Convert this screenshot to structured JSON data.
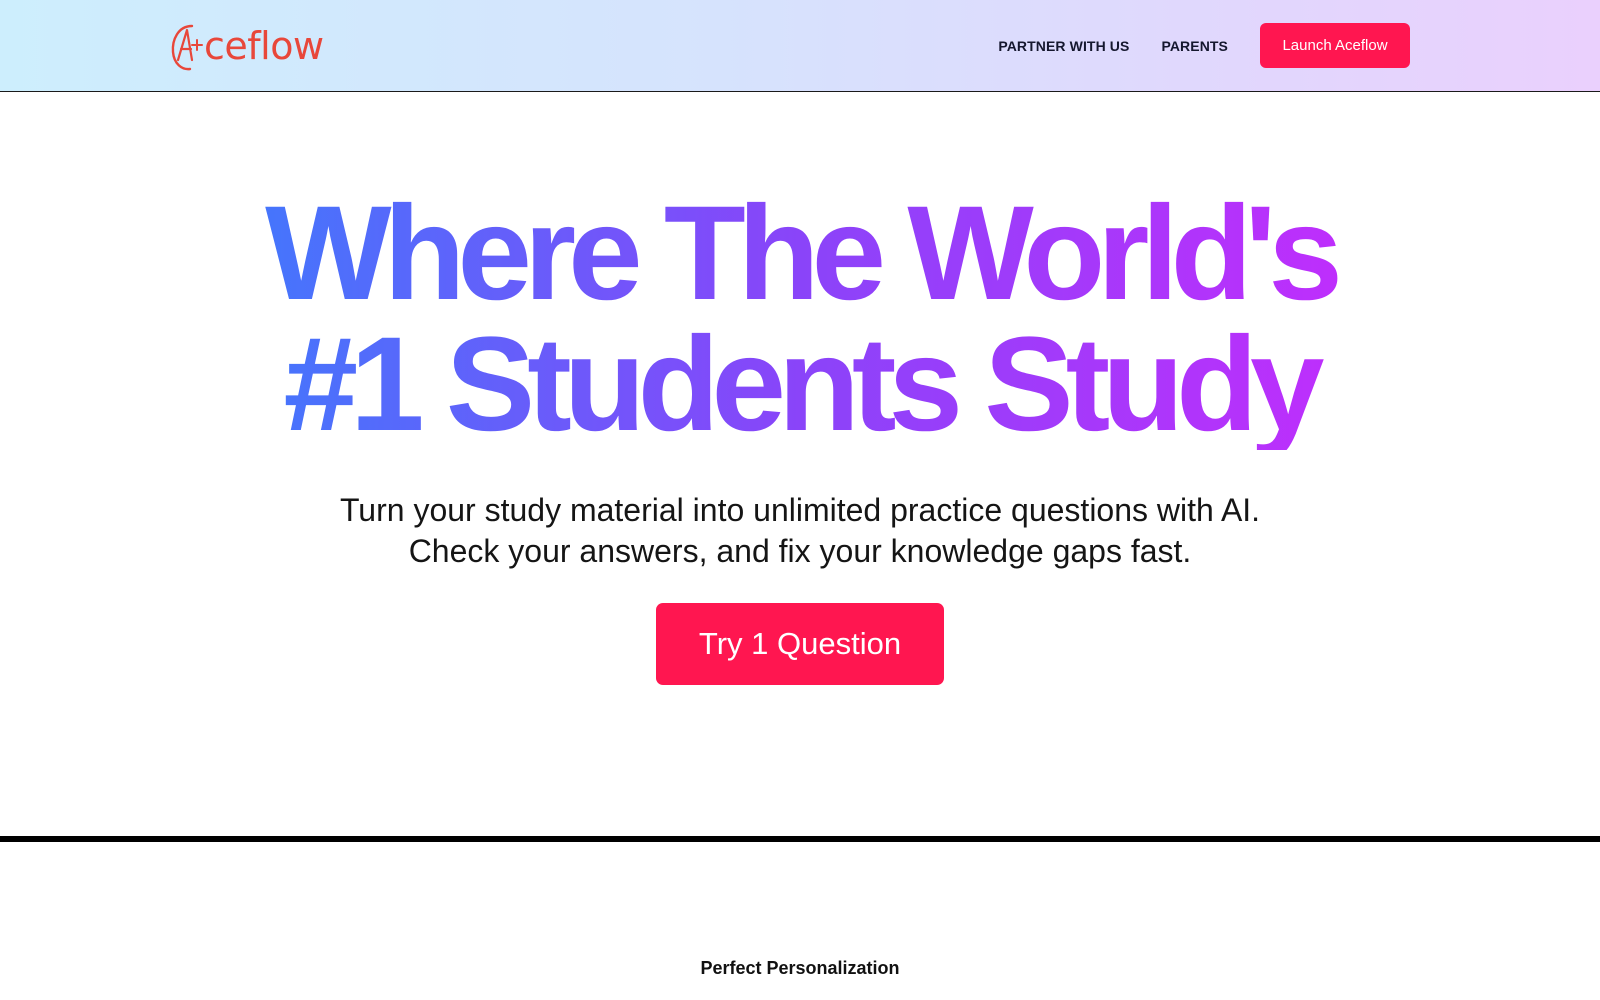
{
  "colors": {
    "brand_red": "#ff1650",
    "logo_red": "#e8473a",
    "headline_gradient_start": "#3d7bfc",
    "headline_gradient_end": "#c42cfc",
    "nav_text": "#15172e"
  },
  "header": {
    "logo_mark": "A+",
    "logo_text": "ceflow",
    "nav_links": [
      {
        "label": "PARTNER WITH US"
      },
      {
        "label": "PARENTS"
      }
    ],
    "launch_label": "Launch Aceflow"
  },
  "hero": {
    "headline_lines": [
      "Where The World's",
      "#1 Students Study"
    ],
    "subtitle_lines": [
      "Turn your study material into unlimited practice questions with AI.",
      "Check your answers, and fix your knowledge gaps fast."
    ],
    "cta_label": "Try 1 Question"
  },
  "next_section": {
    "label": "Perfect Personalization"
  }
}
